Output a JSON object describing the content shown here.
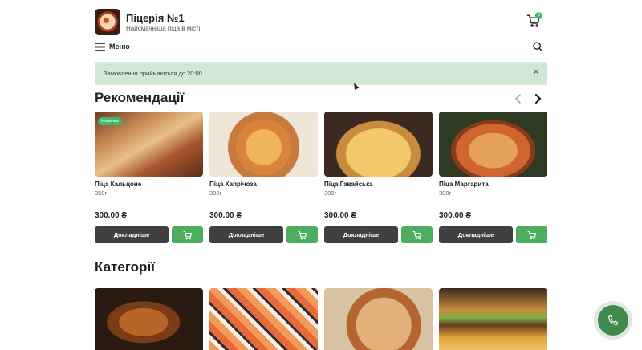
{
  "header": {
    "title": "Піцерія №1",
    "subtitle": "Найсмачніша піца в місті",
    "cart_count": "0"
  },
  "nav": {
    "menu_label": "Меню"
  },
  "notice": {
    "text": "Замовлення приймаються до 20:00",
    "close_icon": "×"
  },
  "recommendations": {
    "title": "Рекомендації",
    "items": [
      {
        "name": "Піца Кальцоне",
        "weight": "350г",
        "price": "300.00 ₴",
        "badge": "Новинка",
        "details_label": "Докладніше"
      },
      {
        "name": "Піца Капрічоза",
        "weight": "300г",
        "price": "300.00 ₴",
        "details_label": "Докладніше"
      },
      {
        "name": "Піца Гавайська",
        "weight": "300г",
        "price": "300.00 ₴",
        "details_label": "Докладніше"
      },
      {
        "name": "Піца Маргарита",
        "weight": "300г",
        "price": "300.00 ₴",
        "details_label": "Докладніше"
      }
    ]
  },
  "categories": {
    "title": "Категорії"
  },
  "colors": {
    "accent_green": "#4cae5e",
    "badge_green": "#3dbb6b",
    "notice_bg": "#cfe9d6",
    "dark_button": "#404040"
  },
  "icons": [
    "cart-icon",
    "menu-icon",
    "search-icon",
    "close-icon",
    "chevron-left-icon",
    "chevron-right-icon",
    "add-to-cart-icon",
    "phone-icon"
  ]
}
